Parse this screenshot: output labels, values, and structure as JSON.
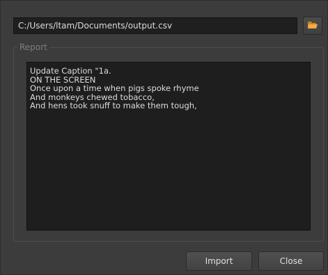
{
  "path": {
    "value": "C:/Users/ltam/Documents/output.csv"
  },
  "browse": {
    "icon": "folder-open-icon",
    "icon_color": "#e8a33a"
  },
  "report": {
    "title": "Report",
    "lines": [
      "Update Caption \"1a.",
      "ON THE SCREEN",
      "Once upon a time when pigs spoke rhyme",
      "And monkeys chewed tobacco,",
      "And hens took snuff to make them tough,"
    ]
  },
  "buttons": {
    "import_label": "Import",
    "close_label": "Close"
  }
}
